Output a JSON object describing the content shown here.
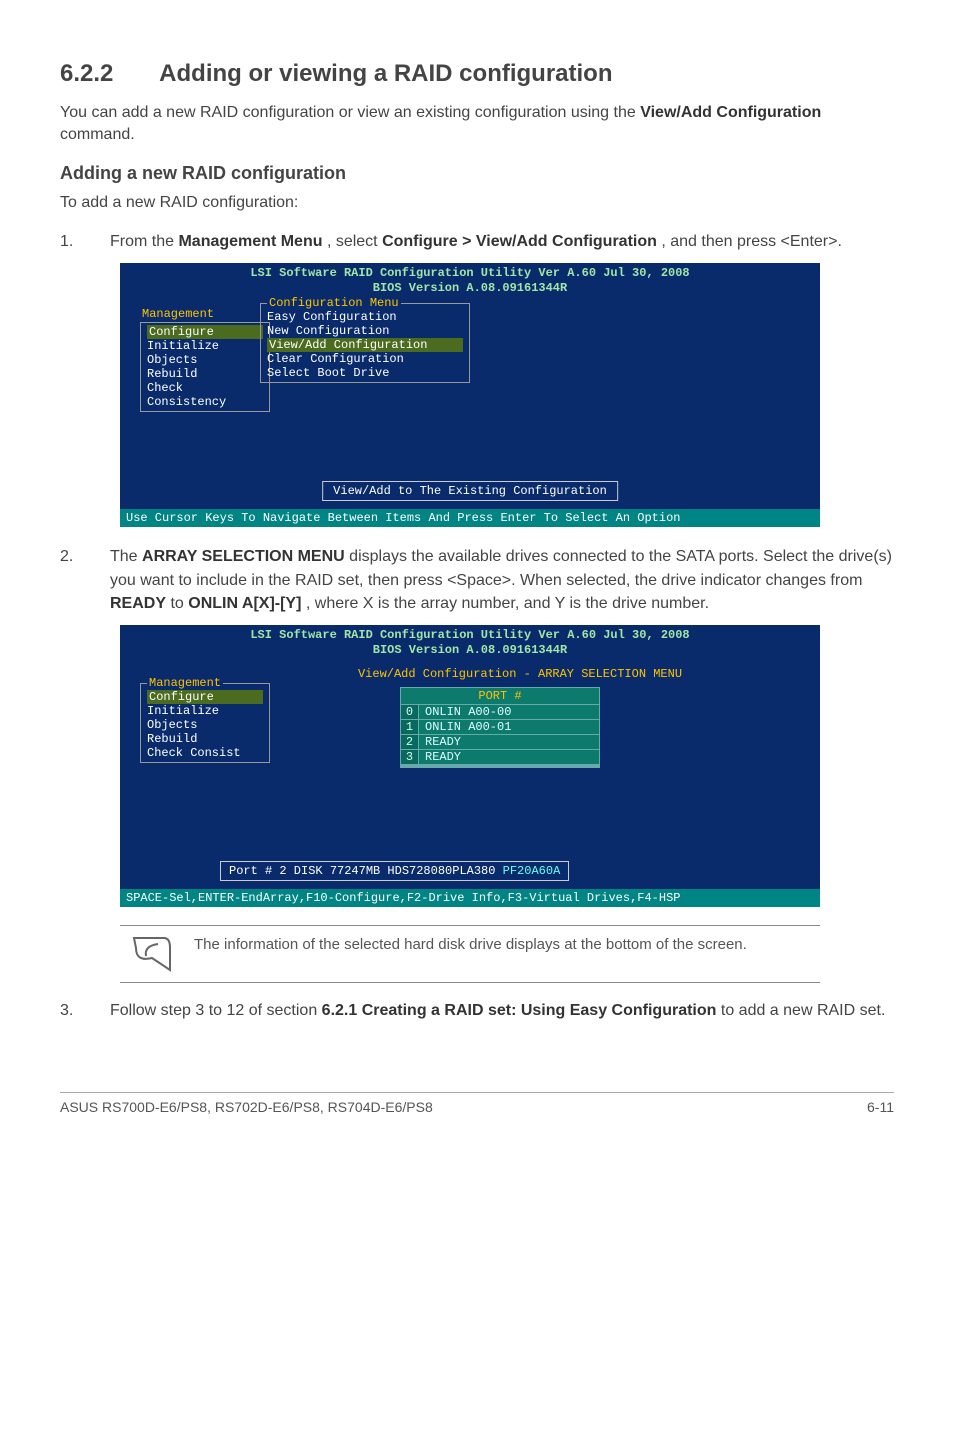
{
  "section": {
    "number": "6.2.2",
    "title": "Adding or viewing a RAID configuration"
  },
  "intro": {
    "pre": "You can add a new RAID configuration or view an existing configuration using the ",
    "bold": "View/Add Configuration",
    "post": " command."
  },
  "sub_heading": "Adding a new RAID configuration",
  "sub_line": "To add a new RAID configuration:",
  "step1": {
    "n": "1.",
    "pre": "From the ",
    "b1": "Management Menu",
    "mid": ", select ",
    "b2": "Configure > View/Add Configuration",
    "post": ", and then press <Enter>."
  },
  "term1": {
    "header_l1": "LSI Software RAID Configuration Utility Ver A.60 Jul 30, 2008",
    "header_l2": "BIOS Version   A.08.09161344R",
    "mgmt_title": "Management",
    "mgmt_items": [
      "Configure",
      "Initialize",
      "Objects",
      "Rebuild",
      "Check Consistency"
    ],
    "conf_title": "Configuration Menu",
    "conf_items": [
      "Easy Configuration",
      "New Configuration",
      "View/Add Configuration",
      "Clear Configuration",
      "Select Boot Drive"
    ],
    "bottom_label": "View/Add to The Existing Configuration",
    "footer": "Use Cursor Keys To Navigate Between Items And Press Enter To Select An Option"
  },
  "step2": {
    "n": "2.",
    "pre": "The ",
    "b1": "ARRAY SELECTION MENU",
    "mid1": " displays the available drives connected to the SATA ports. Select the drive(s) you want to include in the RAID set, then press <Space>. When selected, the drive indicator changes from ",
    "b2": "READY",
    "mid2": " to ",
    "b3": "ONLIN A[X]-[Y]",
    "post": ", where X is the array number, and Y is the drive number."
  },
  "term2": {
    "header_l1": "LSI Software RAID Configuration Utility Ver A.60 Jul 30, 2008",
    "header_l2": "BIOS Version   A.08.09161344R",
    "arr_title": "View/Add Configuration - ARRAY SELECTION MENU",
    "mgmt_title": "Management",
    "mgmt_items": [
      "Configure",
      "Initialize",
      "Objects",
      "Rebuild",
      "Check Consist"
    ],
    "port_header": "PORT #",
    "rows": [
      {
        "i": "0",
        "v": "ONLIN A00-00"
      },
      {
        "i": "1",
        "v": "ONLIN A00-01"
      },
      {
        "i": "2",
        "v": "READY"
      },
      {
        "i": "3",
        "v": "READY"
      },
      {
        "i": "",
        "v": ""
      },
      {
        "i": "",
        "v": ""
      }
    ],
    "portinfo_pre": "Port # 2 DISK   77247MB   HDS728080PLA380   ",
    "portinfo_suf": "PF20A60A",
    "footer": "SPACE-Sel,ENTER-EndArray,F10-Configure,F2-Drive Info,F3-Virtual Drives,F4-HSP"
  },
  "note_text": "The information of the selected hard disk drive displays at the bottom of the screen.",
  "step3": {
    "n": "3.",
    "pre": "Follow step 3 to 12 of section ",
    "b1": "6.2.1 Creating a RAID set: Using Easy Configuration",
    "post": " to add a new RAID set."
  },
  "footer": {
    "left": "ASUS RS700D-E6/PS8, RS702D-E6/PS8, RS704D-E6/PS8",
    "right": "6-11"
  }
}
